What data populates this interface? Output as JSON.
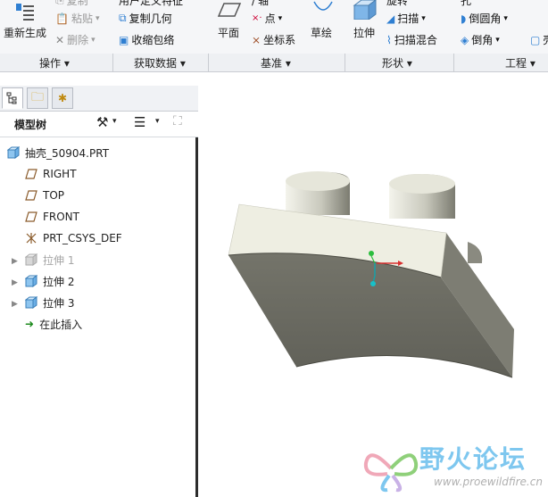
{
  "ribbon": {
    "regenerate_label": "重新生成",
    "copy_label": "复制",
    "paste_label": "粘贴",
    "delete_label": "删除",
    "user_defined_label": "用户定义特征",
    "copy_geometry_label": "复制几何",
    "shrinkwrap_label": "收缩包络",
    "plane_label": "平面",
    "axis_label": "轴",
    "point_label": "点",
    "csys_label": "坐标系",
    "sketch_label": "草绘",
    "extrude_label": "拉伸",
    "revolve_label": "旋转",
    "sweep_label": "扫描",
    "swept_blend_label": "扫描混合",
    "hole_label": "孔",
    "round_label": "倒圆角",
    "chamfer_label": "倒角",
    "shell_label": "壳"
  },
  "groups": {
    "operations": "操作 ▾",
    "get_data": "获取数据 ▾",
    "datum": "基准 ▾",
    "shapes": "形状 ▾",
    "engineering": "工程 ▾"
  },
  "model_tree": {
    "title": "模型树",
    "items": [
      {
        "label": "抽壳_50904.PRT"
      },
      {
        "label": "RIGHT"
      },
      {
        "label": "TOP"
      },
      {
        "label": "FRONT"
      },
      {
        "label": "PRT_CSYS_DEF"
      },
      {
        "label": "拉伸 1"
      },
      {
        "label": "拉伸 2"
      },
      {
        "label": "拉伸 3"
      },
      {
        "label": "在此插入"
      }
    ]
  },
  "watermark": {
    "title": "野火论坛",
    "url": "www.proewildfire.cn"
  },
  "colors": {
    "accent": "#1e7bd0",
    "watermark": "#7ec7ef",
    "model_face": "#6c6c60",
    "model_top": "#eeeee2"
  }
}
